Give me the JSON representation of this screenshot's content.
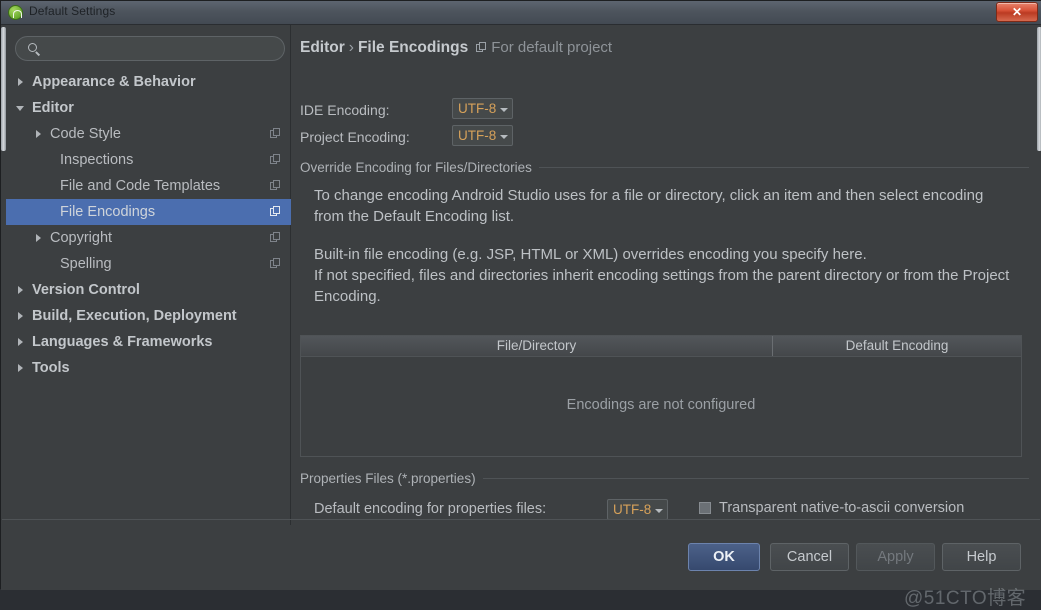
{
  "window": {
    "title": "Default Settings",
    "app_icon": "android-studio-icon",
    "close_label": "✕"
  },
  "sidebar": {
    "search": {
      "value": "",
      "placeholder": "",
      "icon": "search-icon"
    },
    "items": [
      {
        "label": "Appearance & Behavior",
        "arrow": "right",
        "bold": true,
        "indent": 10,
        "icon": false,
        "selected": false
      },
      {
        "label": "Editor",
        "arrow": "down",
        "bold": true,
        "indent": 10,
        "icon": false,
        "selected": false
      },
      {
        "label": "Code Style",
        "arrow": "right",
        "bold": false,
        "indent": 28,
        "icon": true,
        "selected": false
      },
      {
        "label": "Inspections",
        "arrow": "none",
        "bold": false,
        "indent": 38,
        "icon": true,
        "selected": false
      },
      {
        "label": "File and Code Templates",
        "arrow": "none",
        "bold": false,
        "indent": 38,
        "icon": true,
        "selected": false
      },
      {
        "label": "File Encodings",
        "arrow": "none",
        "bold": false,
        "indent": 38,
        "icon": true,
        "selected": true
      },
      {
        "label": "Copyright",
        "arrow": "right",
        "bold": false,
        "indent": 28,
        "icon": true,
        "selected": false
      },
      {
        "label": "Spelling",
        "arrow": "none",
        "bold": false,
        "indent": 38,
        "icon": true,
        "selected": false
      },
      {
        "label": "Version Control",
        "arrow": "right",
        "bold": true,
        "indent": 10,
        "icon": false,
        "selected": false
      },
      {
        "label": "Build, Execution, Deployment",
        "arrow": "right",
        "bold": true,
        "indent": 10,
        "icon": false,
        "selected": false
      },
      {
        "label": "Languages & Frameworks",
        "arrow": "right",
        "bold": true,
        "indent": 10,
        "icon": false,
        "selected": false
      },
      {
        "label": "Tools",
        "arrow": "right",
        "bold": true,
        "indent": 10,
        "icon": false,
        "selected": false
      }
    ]
  },
  "content": {
    "breadcrumb": {
      "parent": "Editor",
      "separator": "›",
      "current": "File Encodings",
      "hint": "For default project"
    },
    "ide_encoding": {
      "label": "IDE Encoding:",
      "value": "UTF-8"
    },
    "project_encoding": {
      "label": "Project Encoding:",
      "value": "UTF-8"
    },
    "override_group": {
      "title": "Override Encoding for Files/Directories",
      "paragraph1": "To change encoding Android Studio uses for a file or directory, click an item and then select encoding from the Default Encoding list.",
      "paragraph2_line1": "Built-in file encoding (e.g. JSP, HTML or XML) overrides encoding you specify here.",
      "paragraph2_line2": "If not specified, files and directories inherit encoding settings from the parent directory or from the Project Encoding."
    },
    "table": {
      "columns": [
        "File/Directory",
        "Default Encoding"
      ],
      "rows": [],
      "empty_text": "Encodings are not configured"
    },
    "properties_group": {
      "title": "Properties Files (*.properties)",
      "default_encoding_label": "Default encoding for properties files:",
      "default_encoding_value": "UTF-8",
      "transparent_checkbox_label": "Transparent native-to-ascii conversion",
      "transparent_checkbox_checked": false
    }
  },
  "buttons": {
    "ok": "OK",
    "cancel": "Cancel",
    "apply": "Apply",
    "help": "Help"
  },
  "watermark": "@51CTO博客",
  "colors": {
    "window_bg": "#3c3f41",
    "selection_blue": "#4b6eaf",
    "combo_text_orange": "#d6a15a",
    "text_primary": "#b9bcc0",
    "close_red": "#d9543a"
  }
}
